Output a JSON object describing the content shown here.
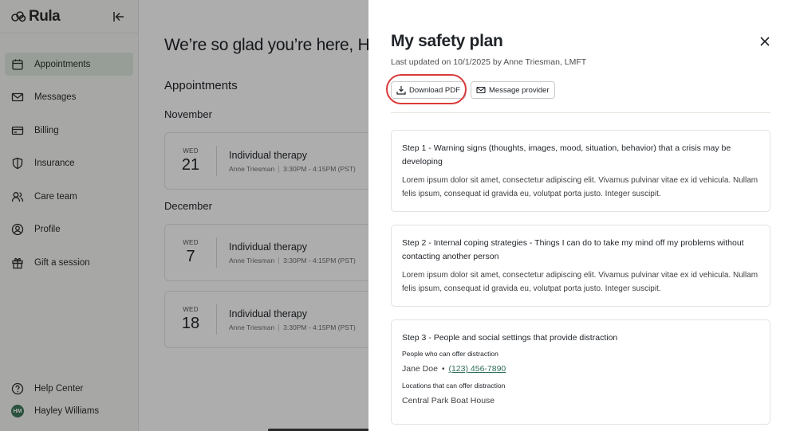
{
  "sidebar": {
    "logo_text": "Rula",
    "items": [
      {
        "label": "Appointments",
        "icon": "calendar-icon",
        "active": true
      },
      {
        "label": "Messages",
        "icon": "mail-icon",
        "active": false
      },
      {
        "label": "Billing",
        "icon": "credit-card-icon",
        "active": false
      },
      {
        "label": "Insurance",
        "icon": "shield-icon",
        "active": false
      },
      {
        "label": "Care team",
        "icon": "users-icon",
        "active": false
      },
      {
        "label": "Profile",
        "icon": "profile-icon",
        "active": false
      },
      {
        "label": "Gift a session",
        "icon": "gift-icon",
        "active": false
      }
    ],
    "help": "Help Center",
    "user": {
      "initials": "HM",
      "name": "Hayley Williams"
    }
  },
  "main": {
    "greeting": "We’re so glad you’re here, H",
    "section_title": "Appointments",
    "months": [
      {
        "label": "November",
        "appointments": [
          {
            "dow": "WED",
            "day": "21",
            "title": "Individual therapy",
            "provider": "Anne Triesman",
            "time": "3:30PM - 4:15PM (PST)"
          }
        ]
      },
      {
        "label": "December",
        "appointments": [
          {
            "dow": "WED",
            "day": "7",
            "title": "Individual therapy",
            "provider": "Anne Triesman",
            "time": "3:30PM - 4:15PM (PST)"
          },
          {
            "dow": "WED",
            "day": "18",
            "title": "Individual therapy",
            "provider": "Anne Triesman",
            "time": "3:30PM - 4:15PM (PST)"
          }
        ]
      }
    ]
  },
  "drawer": {
    "title": "My safety plan",
    "updated": "Last updated on 10/1/2025  by Anne Triesman, LMFT",
    "download_label": "Download PDF",
    "message_label": "Message provider",
    "steps": [
      {
        "title": "Step 1 - Warning signs (thoughts, images, mood, situation, behavior) that a crisis may be developing",
        "body": "Lorem ipsum dolor sit amet, consectetur adipiscing elit. Vivamus pulvinar vitae ex id vehicula. Nullam felis ipsum, consequat id gravida eu, volutpat porta justo. Integer suscipit."
      },
      {
        "title": "Step 2 - Internal coping strategies - Things I can do to take my mind off my problems without contacting another person",
        "body": "Lorem ipsum dolor sit amet, consectetur adipiscing elit. Vivamus pulvinar vitae ex id vehicula. Nullam felis ipsum, consequat id gravida eu, volutpat porta justo. Integer suscipit."
      },
      {
        "title": "Step 3 - People and social settings that provide distraction",
        "people_label": "People who can offer distraction",
        "person_name": "Jane Doe",
        "person_bullet": "•",
        "person_phone": "(123) 456-7890",
        "locations_label": "Locations that can offer distraction",
        "location": "Central Park Boat House"
      }
    ]
  },
  "colors": {
    "accent_green": "#2f6e57",
    "active_nav_bg": "#dde9df",
    "highlight_ring": "#d93a3a",
    "avatar_bg": "#3f7a5a"
  }
}
